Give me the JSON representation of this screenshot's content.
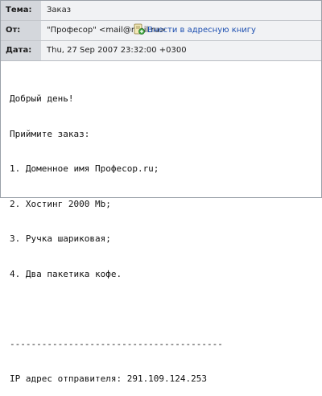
{
  "header": {
    "subject_label": "Тема:",
    "subject_value": "Заказ",
    "from_label": "От:",
    "from_value": "\"Професор\" <mail@mail.ru>",
    "add_to_address_book": "Внести в адресную книгу",
    "date_label": "Дата:",
    "date_value": "Thu, 27 Sep 2007 23:32:00 +0300"
  },
  "body": {
    "lines": [
      "Добрый день!",
      "Приймите заказ:",
      "1. Доменное имя Професор.ru;",
      "2. Хостинг 2000 Mb;",
      "3. Ручка шариковая;",
      "4. Два пакетика кофе."
    ],
    "divider": "----------------------------------------",
    "ip_line": "IP адрес отправителя: 291.109.124.253"
  },
  "icons": {
    "address_book": "address-book-add-icon"
  }
}
